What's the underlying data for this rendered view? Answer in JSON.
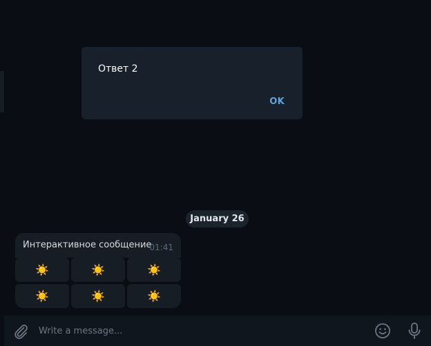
{
  "dialog": {
    "text": "Ответ 2",
    "ok_label": "OK"
  },
  "date_separator": "January 26",
  "message": {
    "text": "Интерактивное сообщение",
    "time": "01:41"
  },
  "keyboard": {
    "buttons": [
      "☀️",
      "☀️",
      "☀️",
      "☀️",
      "☀️",
      "☀️"
    ]
  },
  "composer": {
    "placeholder": "Write a message..."
  },
  "icons": {
    "attach": "paperclip-icon",
    "emoji": "smiley-icon",
    "voice": "microphone-icon"
  },
  "colors": {
    "background": "#0a0e14",
    "dialog": "#18212b",
    "accent": "#5ea4df",
    "bubble": "#161d25"
  }
}
